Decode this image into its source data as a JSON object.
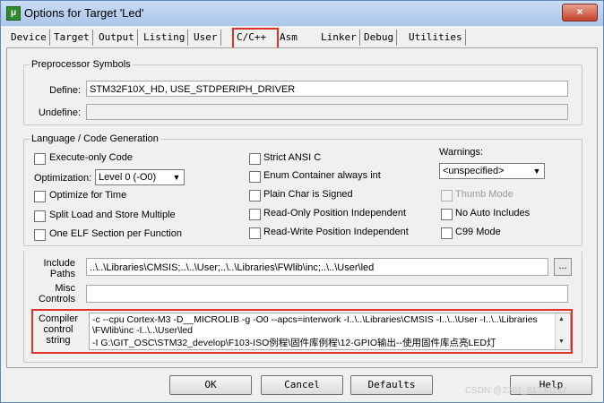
{
  "window": {
    "title": "Options for Target 'Led'",
    "close": "×",
    "app_icon": "μ"
  },
  "tabs": [
    "Device",
    "Target",
    "Output",
    "Listing",
    "User",
    "C/C++",
    "Asm",
    "Linker",
    "Debug",
    "Utilities"
  ],
  "preprocessor": {
    "legend": "Preprocessor Symbols",
    "define_label": "Define:",
    "define_value": "STM32F10X_HD, USE_STDPERIPH_DRIVER",
    "undefine_label": "Undefine:",
    "undefine_value": ""
  },
  "language": {
    "legend": "Language / Code Generation",
    "execute_only": "Execute-only Code",
    "optimization_label": "Optimization:",
    "optimization_value": "Level 0 (-O0)",
    "optimize_time": "Optimize for Time",
    "split_load": "Split Load and Store Multiple",
    "one_elf": "One ELF Section per Function",
    "strict_ansi": "Strict ANSI C",
    "enum_container": "Enum Container always int",
    "plain_char": "Plain Char is Signed",
    "ropi": "Read-Only Position Independent",
    "rwpi": "Read-Write Position Independent",
    "warnings_label": "Warnings:",
    "warnings_value": "<unspecified>",
    "thumb_mode": "Thumb Mode",
    "no_auto_includes": "No Auto Includes",
    "c99_mode": "C99 Mode"
  },
  "include": {
    "label_1": "Include",
    "label_2": "Paths",
    "value": "..\\..\\Libraries\\CMSIS;..\\..\\User;..\\..\\Libraries\\FWlib\\inc;..\\..\\User\\led",
    "browse": "..."
  },
  "misc": {
    "label_1": "Misc",
    "label_2": "Controls",
    "value": ""
  },
  "compiler": {
    "label_1": "Compiler",
    "label_2": "control",
    "label_3": "string",
    "line_1": "-c --cpu Cortex-M3 -D__MICROLIB -g -O0 --apcs=interwork -I..\\..\\Libraries\\CMSIS -I..\\..\\User -I..\\..\\Libraries",
    "line_2": "\\FWlib\\inc -I..\\..\\User\\led",
    "line_3": "-I G:\\GIT_OSC\\STM32_develop\\F103-ISO例程\\固件库例程\\12-GPIO输出--使用固件库点亮LED灯"
  },
  "buttons": {
    "ok": "OK",
    "cancel": "Cancel",
    "defaults": "Defaults",
    "help": "Help"
  },
  "watermark": "CSDN @2301_81730147"
}
